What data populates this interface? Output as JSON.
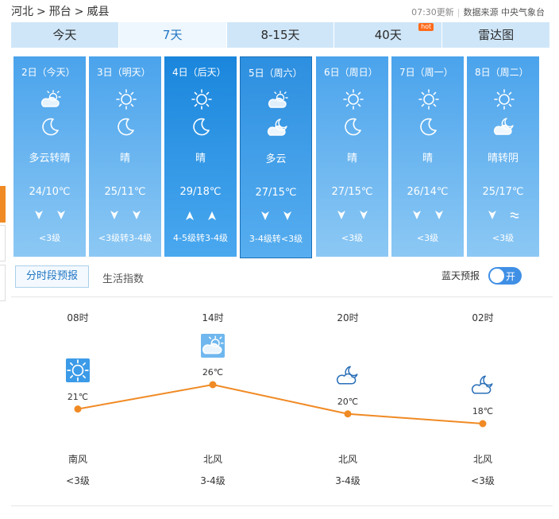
{
  "breadcrumb": [
    "河北",
    ">",
    "邢台",
    ">",
    "威县"
  ],
  "update": {
    "time": "07:30更新",
    "source": "数据来源 中央气象台"
  },
  "tabs": [
    {
      "label": "今天",
      "active": false
    },
    {
      "label": "7天",
      "active": true
    },
    {
      "label": "8-15天",
      "active": false
    },
    {
      "label": "40天",
      "badge": "hot",
      "active": false
    },
    {
      "label": "雷达图",
      "active": false
    }
  ],
  "days": [
    {
      "date": "2日（今天）",
      "day_icon": "partly-cloudy-sun-icon",
      "night_icon": "moon-icon",
      "desc": "多云转晴",
      "temp": "24/10℃",
      "wind_icons": [
        "down",
        "down"
      ],
      "level": "<3级",
      "style": "normal"
    },
    {
      "date": "3日（明天）",
      "day_icon": "sun-icon",
      "night_icon": "moon-icon",
      "desc": "晴",
      "temp": "25/11℃",
      "wind_icons": [
        "down",
        "down"
      ],
      "level": "<3级转3-4级",
      "style": "normal"
    },
    {
      "date": "4日（后天）",
      "day_icon": "sun-icon",
      "night_icon": "moon-icon",
      "desc": "晴",
      "temp": "29/18℃",
      "wind_icons": [
        "up",
        "up"
      ],
      "level": "4-5级转3-4级",
      "style": "current"
    },
    {
      "date": "5日（周六）",
      "day_icon": "partly-cloudy-sun-icon",
      "night_icon": "cloudy-night-icon",
      "desc": "多云",
      "temp": "27/15℃",
      "wind_icons": [
        "down",
        "down"
      ],
      "level": "3-4级转<3级",
      "style": "selected"
    },
    {
      "date": "6日（周日）",
      "day_icon": "sun-icon",
      "night_icon": "moon-icon",
      "desc": "晴",
      "temp": "27/15℃",
      "wind_icons": [
        "down",
        "down"
      ],
      "level": "<3级",
      "style": "normal"
    },
    {
      "date": "7日（周一）",
      "day_icon": "sun-icon",
      "night_icon": "moon-icon",
      "desc": "晴",
      "temp": "26/14℃",
      "wind_icons": [
        "down",
        "down"
      ],
      "level": "<3级",
      "style": "normal"
    },
    {
      "date": "8日（周二）",
      "day_icon": "sun-icon",
      "night_icon": "cloudy-night-icon",
      "desc": "晴转阴",
      "temp": "25/17℃",
      "wind_icons": [
        "down",
        "wave"
      ],
      "level": "<3级",
      "style": "normal"
    }
  ],
  "subtabs": {
    "hourly": "分时段预报",
    "life": "生活指数"
  },
  "bluesky": {
    "label": "蓝天预报",
    "toggle": "开"
  },
  "hourly": [
    {
      "time": "08时",
      "icon": "sun-icon",
      "temp": 21,
      "temp_label": "21℃",
      "wind": "南风",
      "level": "<3级"
    },
    {
      "time": "14时",
      "icon": "partly-cloudy-sun-icon",
      "temp": 26,
      "temp_label": "26℃",
      "wind": "北风",
      "level": "3-4级"
    },
    {
      "time": "20时",
      "icon": "cloudy-night-icon",
      "temp": 20,
      "temp_label": "20℃",
      "wind": "北风",
      "level": "3-4级"
    },
    {
      "time": "02时",
      "icon": "cloudy-night-icon",
      "temp": 18,
      "temp_label": "18℃",
      "wind": "北风",
      "level": "<3级"
    }
  ],
  "colors": {
    "line": "#f08a24",
    "accent": "#1f75c4"
  }
}
